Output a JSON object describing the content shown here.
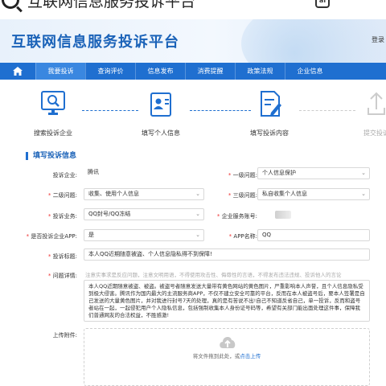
{
  "search": {
    "query": "互联网信息服务投诉平台"
  },
  "header": {
    "title": "互联网信息服务投诉平台",
    "login": "登录"
  },
  "nav": {
    "items": [
      {
        "label": "我要投诉",
        "active": true
      },
      {
        "label": "查询评价",
        "active": false
      },
      {
        "label": "信息发布",
        "active": false
      },
      {
        "label": "消费提醒",
        "active": false
      },
      {
        "label": "政策法规",
        "active": false
      },
      {
        "label": "企业信息",
        "active": false
      }
    ]
  },
  "steps": [
    {
      "label": "搜索投诉企业",
      "icon": "monitor-search-icon",
      "state": "done"
    },
    {
      "label": "填写个人信息",
      "icon": "id-card-icon",
      "state": "done"
    },
    {
      "label": "填写投诉内容",
      "icon": "document-edit-icon",
      "state": "current"
    },
    {
      "label": "提交投诉",
      "icon": "upload-icon",
      "state": "pending"
    }
  ],
  "form": {
    "section_title": "填写投诉信息",
    "complaint_company": {
      "label": "投诉企业:",
      "value": "腾讯"
    },
    "level1_issue": {
      "label": "一级问题:",
      "value": "个人信息保护"
    },
    "level2_issue": {
      "label": "二级问题:",
      "value": "收集、使用个人信息"
    },
    "level3_issue": {
      "label": "三级问题:",
      "value": "私自收集个人信息"
    },
    "business": {
      "label": "投诉业务:",
      "value": "QQ封号/QQ冻结"
    },
    "service_account": {
      "label": "企业服务账号:",
      "value": ""
    },
    "app_complaint": {
      "label": "是否投诉企业APP:",
      "value": "是"
    },
    "app_name": {
      "label": "APP名称:",
      "value": "QQ"
    },
    "complaint_title": {
      "label": "投诉标题:",
      "value": "本人QQ近期随意被盗、个人信息隐私得不到保障!"
    },
    "complaint_detail": {
      "label": "问题详情:",
      "hint": "注意实事求是反应问题，注意文明用语，不得使用攻击性、侮辱性的言语，不得发布违法违规、投诉他人的言论",
      "text": "本人QQ近期随意被盗、被盗。被盗号者随意发送大量带有黄色网站的黄色图片，严重影响本人声誉，且个人信息隐私受到极大侵害。腾讯作为国内最大的主流服务商APP，不仅不建立安全可靠的平台，反而在本人被盗号后，要本人签署是自己发送的大量黄色图片，并对我进行封号7天的处理，真的是有苦说不出!自己不知道反省自己，单一投诉，反而和盗号者站在一起，一起侵犯用户个人隐私信息，包括强制收集本人身份证号码等，希望有关部门能出面处理这件事，保障我们普通网友的合法权益，不胜感激!"
    },
    "attachment": {
      "label": "上传附件:",
      "drop_text": "将文件拖到此处，或",
      "click_text": "点击上传"
    }
  }
}
